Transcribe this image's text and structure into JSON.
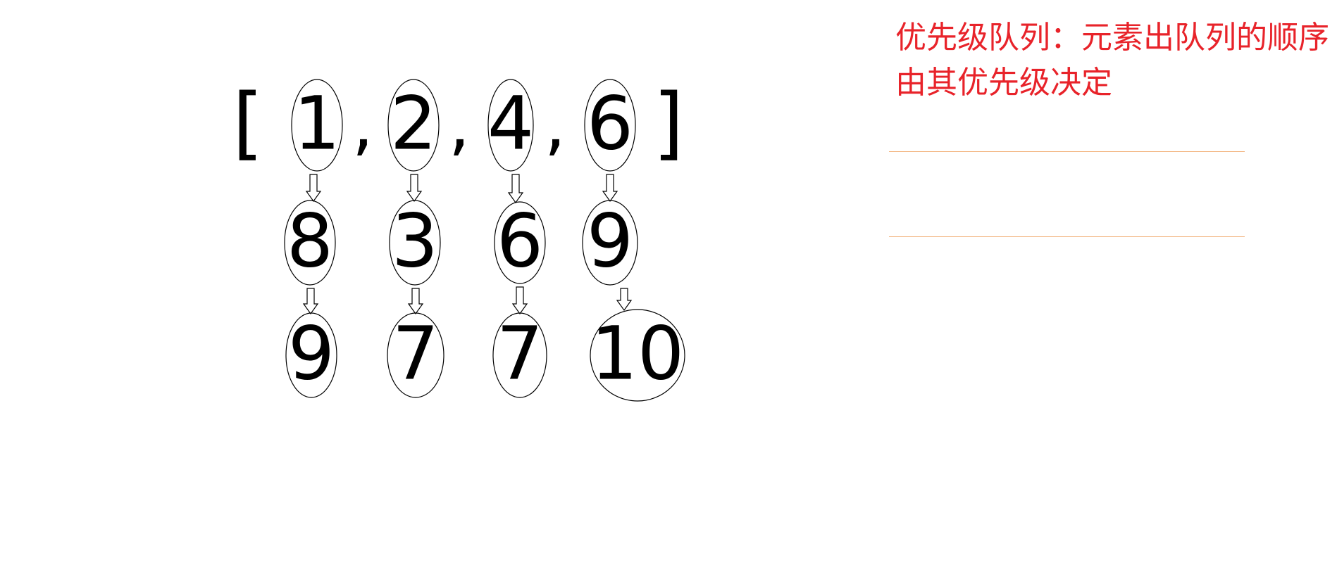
{
  "diagram": {
    "open_bracket": "[",
    "close_bracket": "]",
    "separator": ",",
    "top_row": [
      "1",
      "2",
      "4",
      "6"
    ],
    "chains": [
      [
        "8",
        "9"
      ],
      [
        "3",
        "7"
      ],
      [
        "6",
        "7"
      ],
      [
        "9",
        "10"
      ]
    ]
  },
  "note": {
    "text": "优先级队列：元素出队列的顺序由其优先级决定",
    "color": "#e8232a"
  },
  "colors": {
    "rule": "#f2b27c",
    "ink": "#000000"
  }
}
